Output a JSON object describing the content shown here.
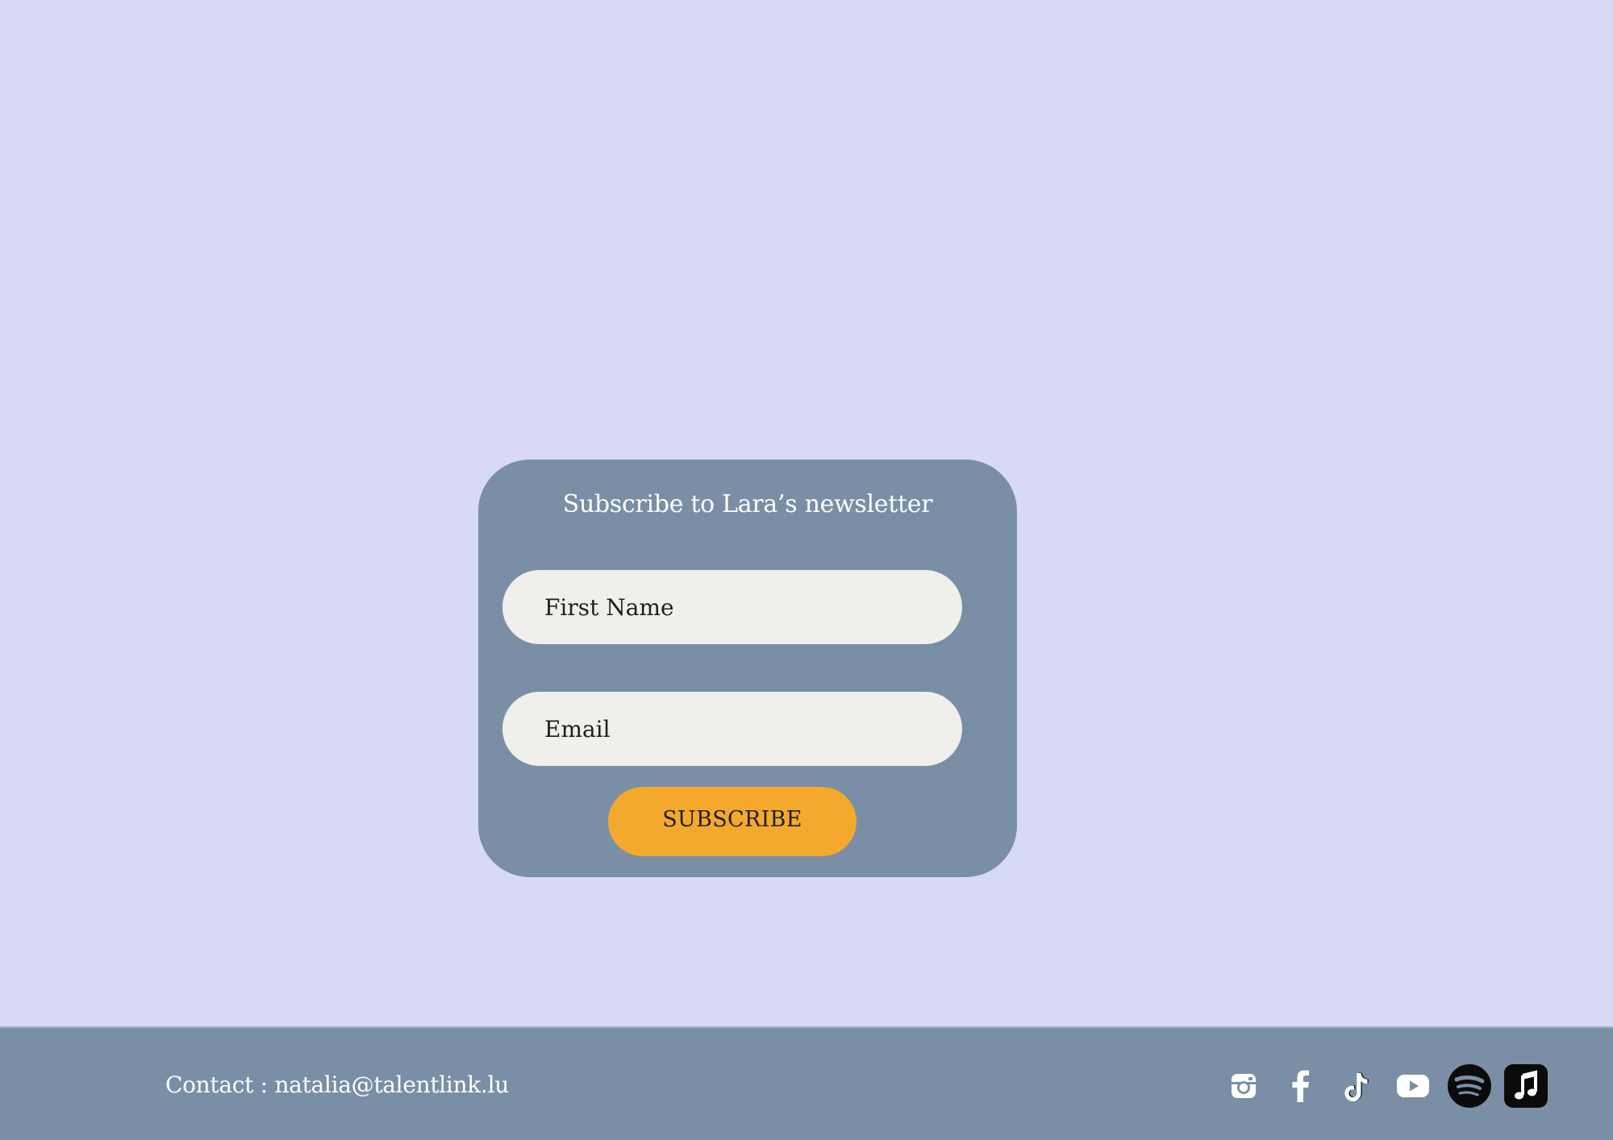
{
  "newsletter": {
    "title": "Subscribe to Lara’s newsletter",
    "first_name_placeholder": "First Name",
    "email_placeholder": "Email",
    "subscribe_label": "SUBSCRIBE"
  },
  "footer": {
    "contact_prefix": "Contact : ",
    "contact_email": "natalia@talentlink.lu",
    "socials": [
      {
        "name": "instagram-icon"
      },
      {
        "name": "facebook-icon"
      },
      {
        "name": "tiktok-icon"
      },
      {
        "name": "youtube-icon"
      },
      {
        "name": "spotify-icon"
      },
      {
        "name": "apple-music-icon"
      }
    ]
  },
  "colors": {
    "background": "#d8d9f4",
    "panel": "#7a8fa6",
    "input_background": "#f1efeb",
    "button": "#f4a92d"
  }
}
